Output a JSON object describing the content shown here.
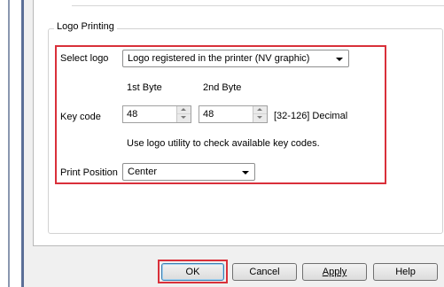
{
  "group": {
    "title": "Logo Printing"
  },
  "select_logo": {
    "label": "Select logo",
    "value": "Logo registered in the printer (NV graphic)"
  },
  "key_code": {
    "label": "Key code",
    "byte1_header": "1st Byte",
    "byte2_header": "2nd Byte",
    "byte1_value": "48",
    "byte2_value": "48",
    "range_note": "[32-126] Decimal",
    "hint": "Use logo utility to check available key codes."
  },
  "print_position": {
    "label": "Print Position",
    "value": "Center"
  },
  "buttons": {
    "ok": "OK",
    "cancel": "Cancel",
    "apply": "Apply",
    "help": "Help"
  },
  "colors": {
    "highlight": "#d9303a",
    "accent": "#5b6f97"
  }
}
